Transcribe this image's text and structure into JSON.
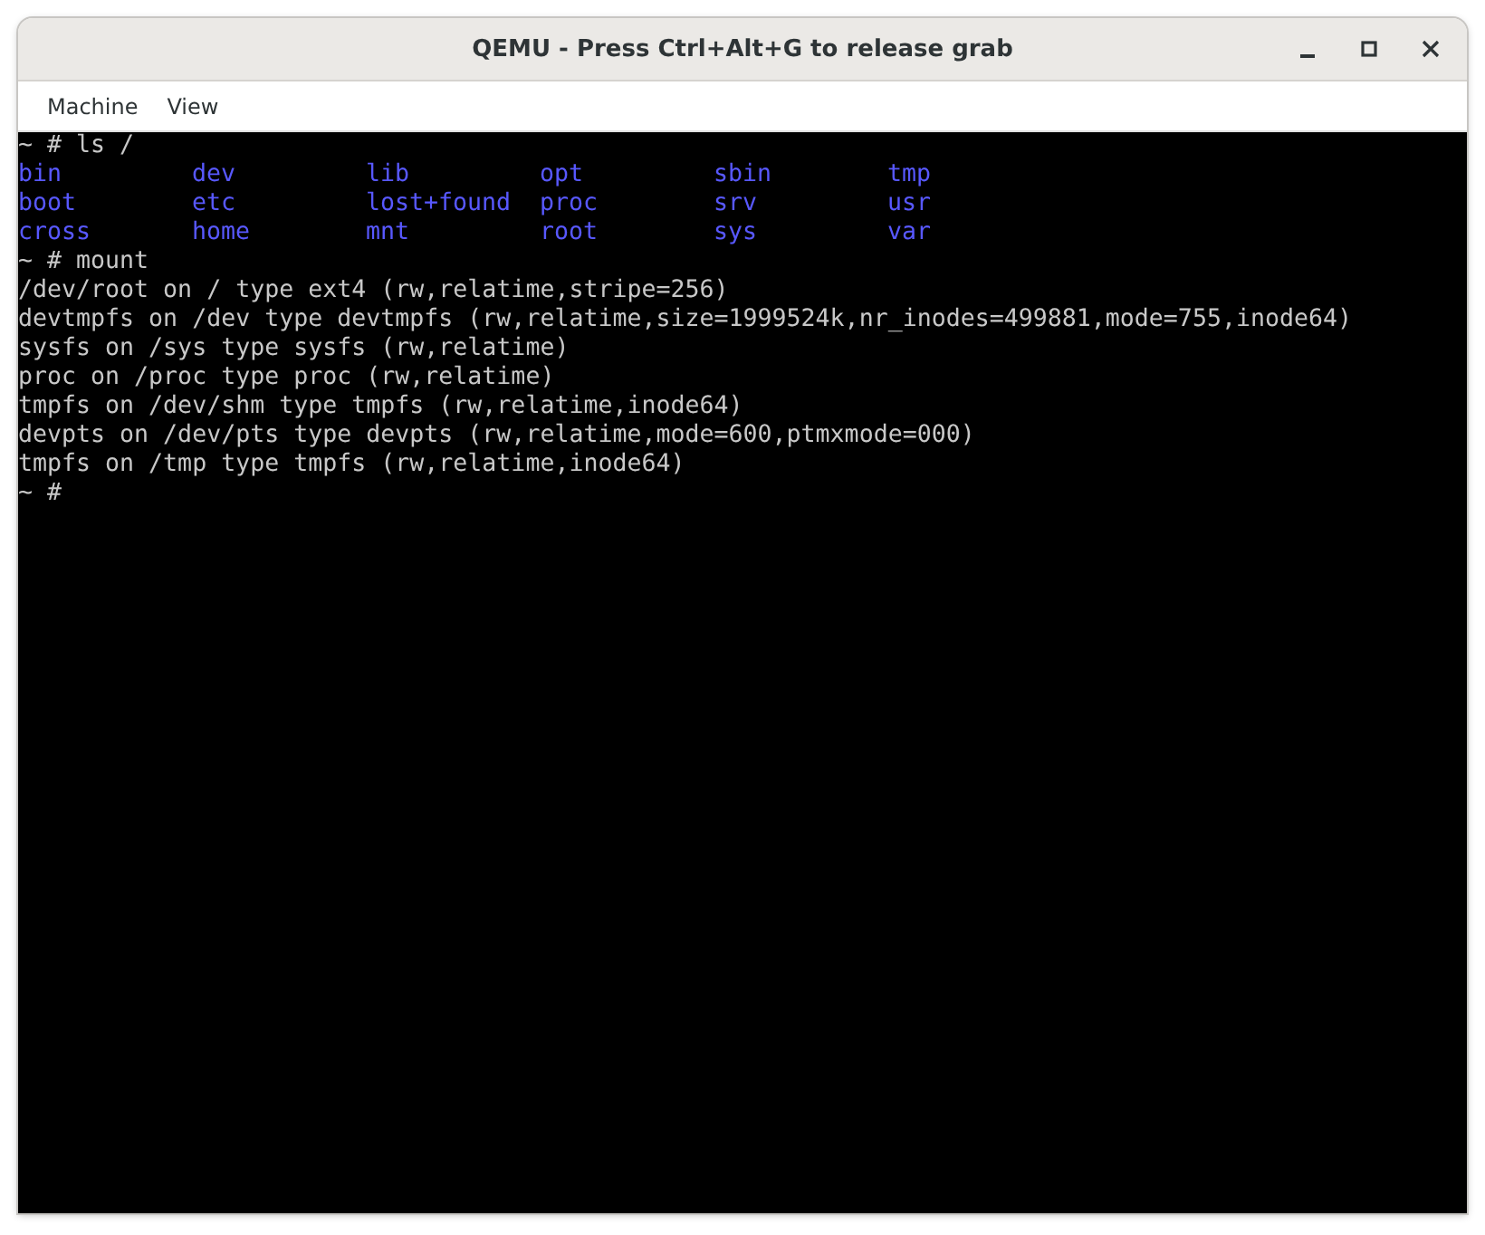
{
  "window": {
    "title": "QEMU - Press Ctrl+Alt+G to release grab"
  },
  "menu": [
    "Machine",
    "View"
  ],
  "terminal": {
    "lines": [
      {
        "kind": "text",
        "text": "~ # ls /"
      },
      {
        "kind": "listing",
        "entries": [
          "bin",
          "dev",
          "lib",
          "opt",
          "sbin",
          "tmp"
        ]
      },
      {
        "kind": "listing",
        "entries": [
          "boot",
          "etc",
          "lost+found",
          "proc",
          "srv",
          "usr"
        ]
      },
      {
        "kind": "listing",
        "entries": [
          "cross",
          "home",
          "mnt",
          "root",
          "sys",
          "var"
        ]
      },
      {
        "kind": "text",
        "text": "~ # mount"
      },
      {
        "kind": "text",
        "text": "/dev/root on / type ext4 (rw,relatime,stripe=256)"
      },
      {
        "kind": "text",
        "text": "devtmpfs on /dev type devtmpfs (rw,relatime,size=1999524k,nr_inodes=499881,mode=755,inode64)"
      },
      {
        "kind": "text",
        "text": "sysfs on /sys type sysfs (rw,relatime)"
      },
      {
        "kind": "text",
        "text": "proc on /proc type proc (rw,relatime)"
      },
      {
        "kind": "text",
        "text": "tmpfs on /dev/shm type tmpfs (rw,relatime,inode64)"
      },
      {
        "kind": "text",
        "text": "devpts on /dev/pts type devpts (rw,relatime,mode=600,ptmxmode=000)"
      },
      {
        "kind": "text",
        "text": "tmpfs on /tmp type tmpfs (rw,relatime,inode64)"
      },
      {
        "kind": "text",
        "text": "~ #"
      }
    ]
  }
}
